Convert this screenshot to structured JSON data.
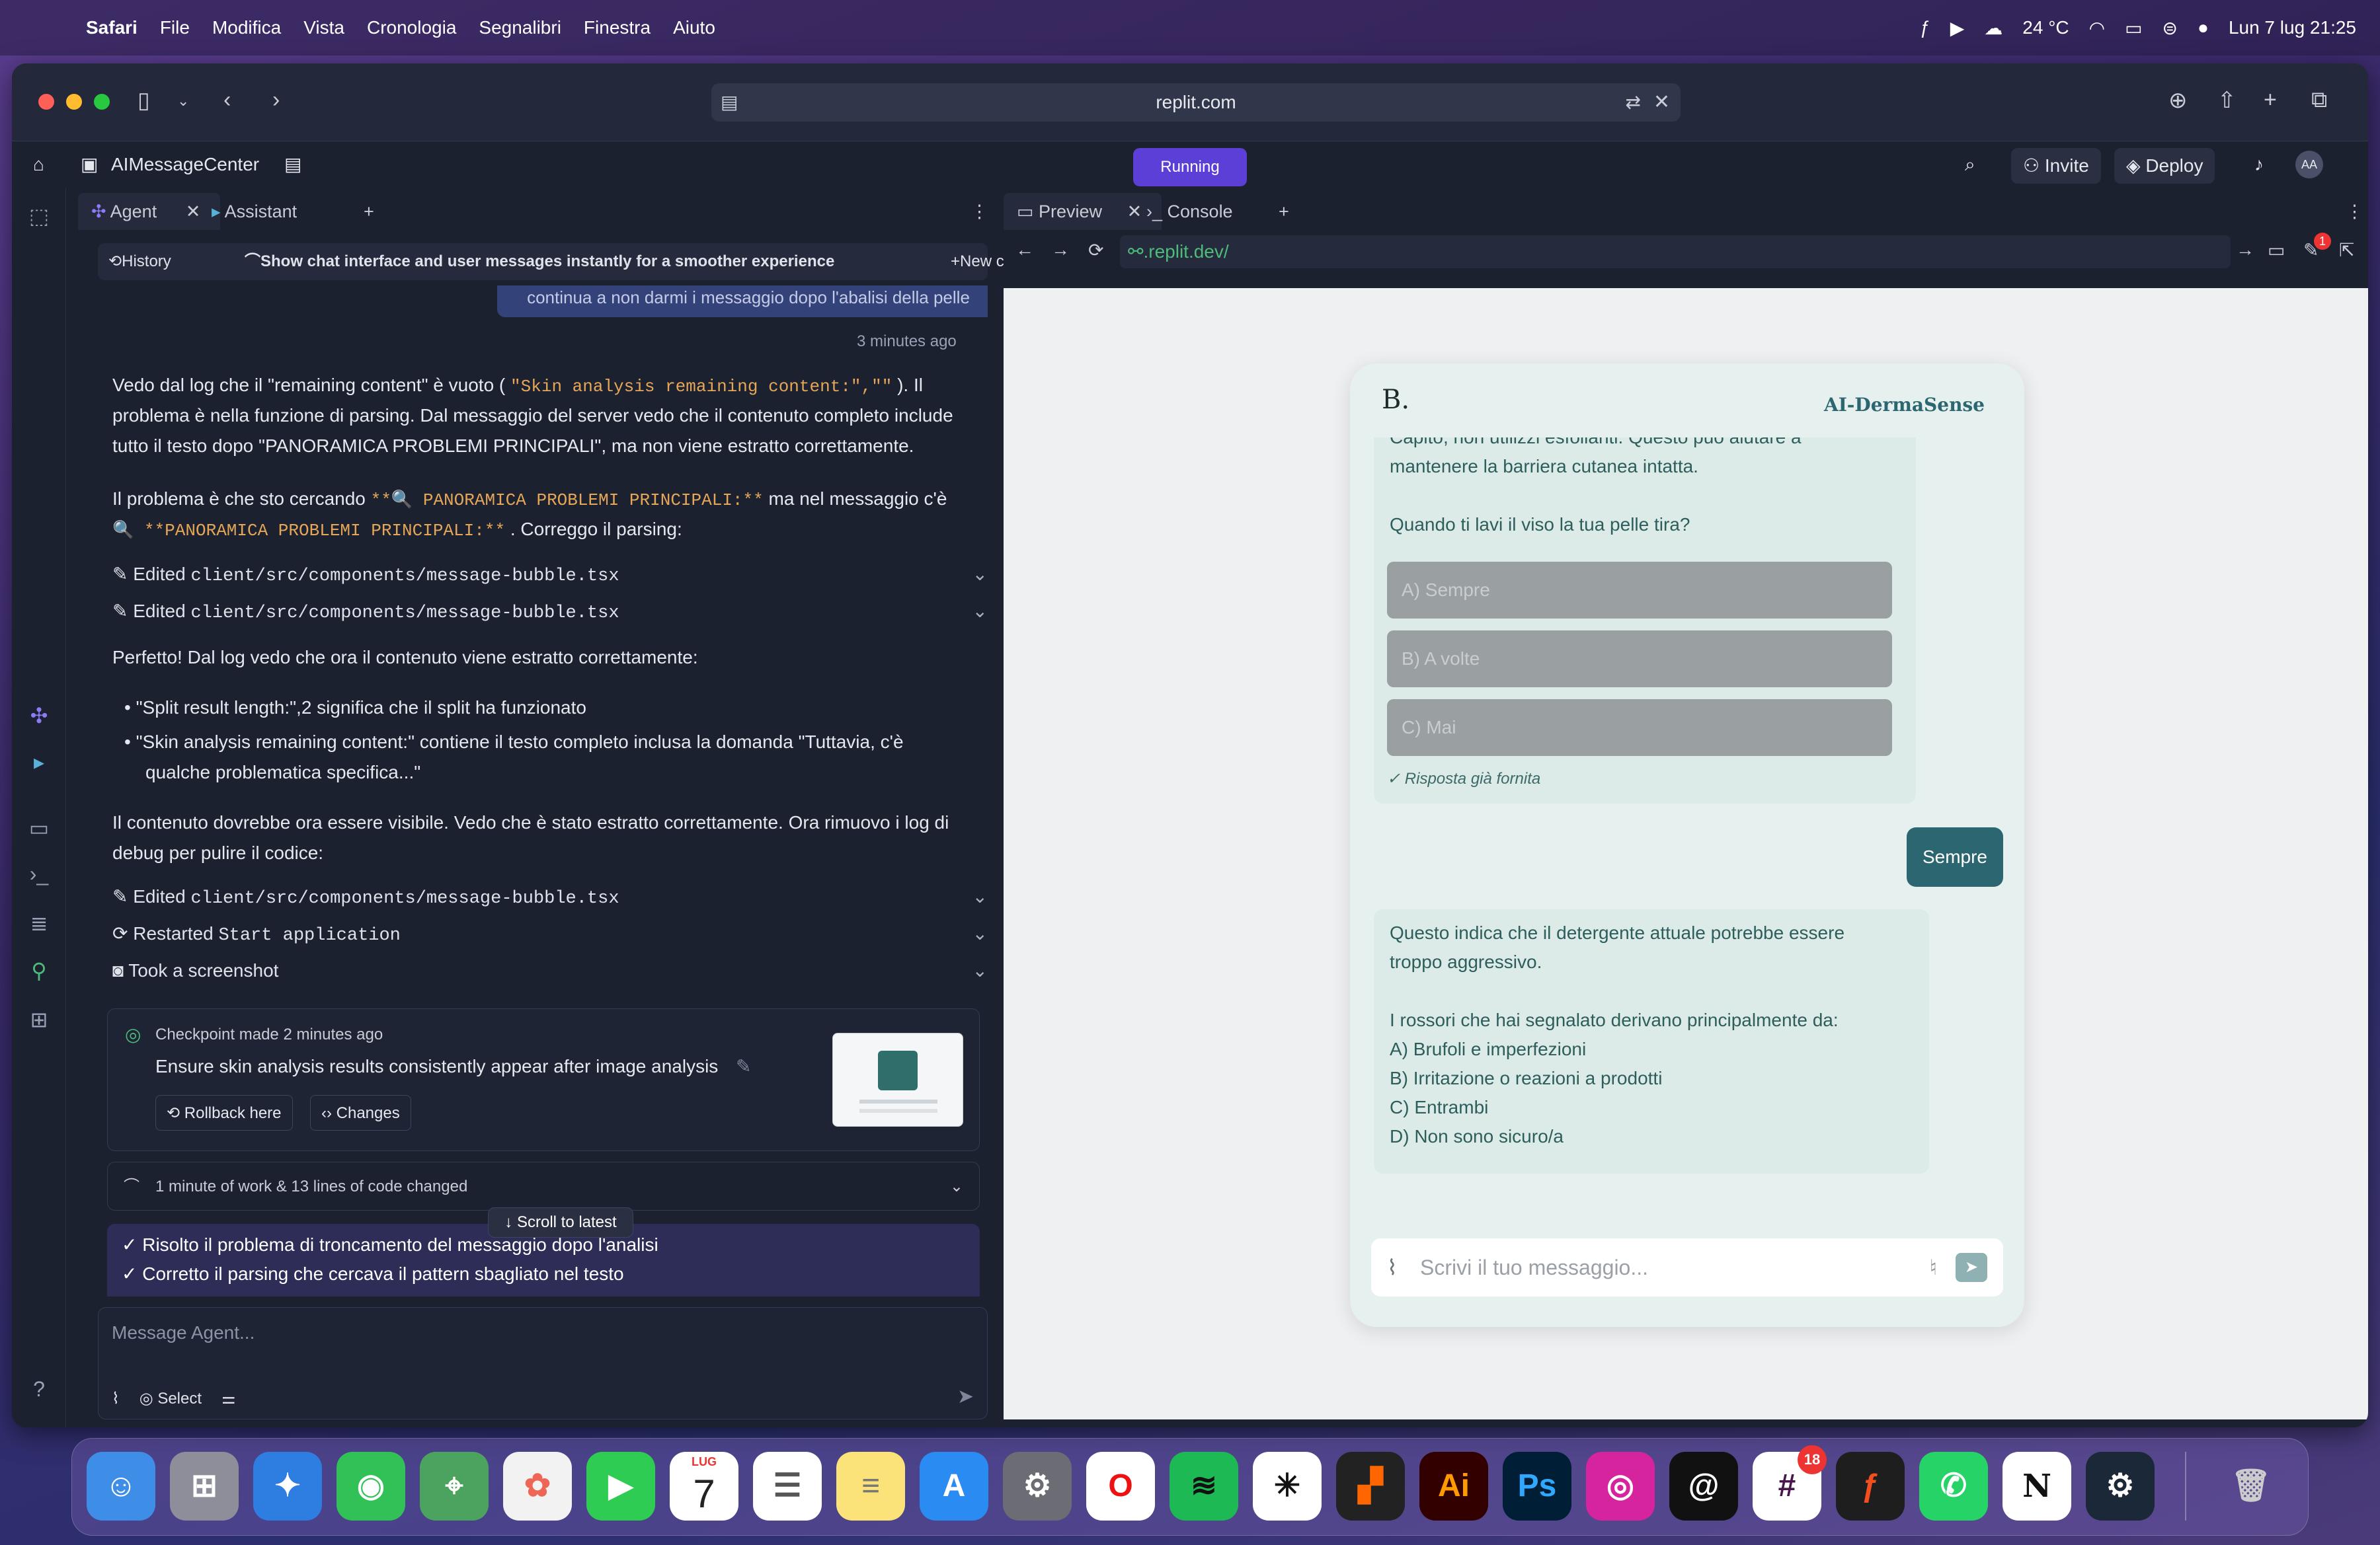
{
  "menubar": {
    "app": "Safari",
    "items": [
      "File",
      "Modifica",
      "Vista",
      "Cronologia",
      "Segnalibri",
      "Finestra",
      "Aiuto"
    ],
    "weather": "24 °C",
    "datetime": "Lun 7 lug  21:25"
  },
  "browser": {
    "url": "replit.com"
  },
  "replit": {
    "project": "AIMessageCenter",
    "status": "Running",
    "invite": "Invite",
    "deploy": "Deploy",
    "avatar": "AA"
  },
  "agent": {
    "tabs": [
      "Agent",
      "Assistant"
    ],
    "history": "History",
    "task": "Show chat interface and user messages instantly for a smoother experience",
    "new_chat": "New chat",
    "user_bubble": "continua a non darmi i messaggio dopo l'abalisi della pelle",
    "timestamp": "3 minutes ago",
    "p1a": "Vedo dal log che il \"remaining content\" è vuoto ( ",
    "p1code": "\"Skin analysis remaining content:\",\"\"",
    "p1b": " ). Il",
    "p1c": "problema è nella funzione di parsing. Dal messaggio del server vedo che il contenuto completo include",
    "p1d": "tutto il testo dopo \"PANORAMICA PROBLEMI PRINCIPALI\", ma non viene estratto correttamente.",
    "p2a": "Il problema è che sto cercando ",
    "p2code1": "**🔍 PANORAMICA PROBLEMI PRINCIPALI:**",
    "p2b": " ma nel messaggio c'è",
    "p2code2": "🔍 **PANORAMICA PROBLEMI PRINCIPALI:**",
    "p2c": " . Correggo il parsing:",
    "edited_label": "Edited",
    "edited_file": "client/src/components/message-bubble.tsx",
    "p3": "Perfetto! Dal log vedo che ora il contenuto viene estratto correttamente:",
    "bullet1": "\"Split result length:\",2 significa che il split ha funzionato",
    "bullet2a": "\"Skin analysis remaining content:\" contiene il testo completo inclusa la domanda \"Tuttavia, c'è",
    "bullet2b": "qualche problematica specifica...\"",
    "p4a": "Il contenuto dovrebbe ora essere visibile. Vedo che è stato estratto correttamente. Ora rimuovo i log di",
    "p4b": "debug per pulire il codice:",
    "restarted_label": "Restarted",
    "restarted_target": "Start application",
    "screenshot": "Took a screenshot",
    "checkpoint_title": "Checkpoint made 2 minutes ago",
    "checkpoint_desc": "Ensure skin analysis results consistently appear after image analysis",
    "rollback": "Rollback here",
    "changes": "Changes",
    "work_summary": "1 minute of work & 13 lines of code changed",
    "scroll_latest": "Scroll to latest",
    "summary1": "✓ Risolto il problema di troncamento del messaggio dopo l'analisi",
    "summary2": "✓ Corretto il parsing che cercava il pattern sbagliato nel testo",
    "input_placeholder": "Message Agent...",
    "select": "Select"
  },
  "preview": {
    "tabs": [
      "Preview",
      "Console"
    ],
    "url": ".replit.dev/",
    "badge": "1",
    "logo": "B.",
    "brand": "AI-DermaSense",
    "msg1a": "Capito, non utilizzi esfolianti. Questo può aiutare a",
    "msg1b": "mantenere la barriera cutanea intatta.",
    "msg1c": "Quando ti lavi il viso la tua pelle tira?",
    "options": [
      {
        "letter": "A)",
        "text": "Sempre"
      },
      {
        "letter": "B)",
        "text": "A volte"
      },
      {
        "letter": "C)",
        "text": "Mai"
      }
    ],
    "answered": "✓ Risposta già fornita",
    "user_reply": "Sempre",
    "msg2a": "Questo indica che il detergente attuale potrebbe essere",
    "msg2b": "troppo aggressivo.",
    "msg2c": "I rossori che hai segnalato derivano principalmente da:",
    "msg2_items": [
      "A) Brufoli e imperfezioni",
      "B) Irritazione o reazioni a prodotti",
      "C) Entrambi",
      "D) Non sono sicuro/a"
    ],
    "composer_placeholder": "Scrivi il tuo messaggio..."
  },
  "dock": {
    "calendar_month": "LUG",
    "calendar_day": "7",
    "slack_badge": "18"
  }
}
